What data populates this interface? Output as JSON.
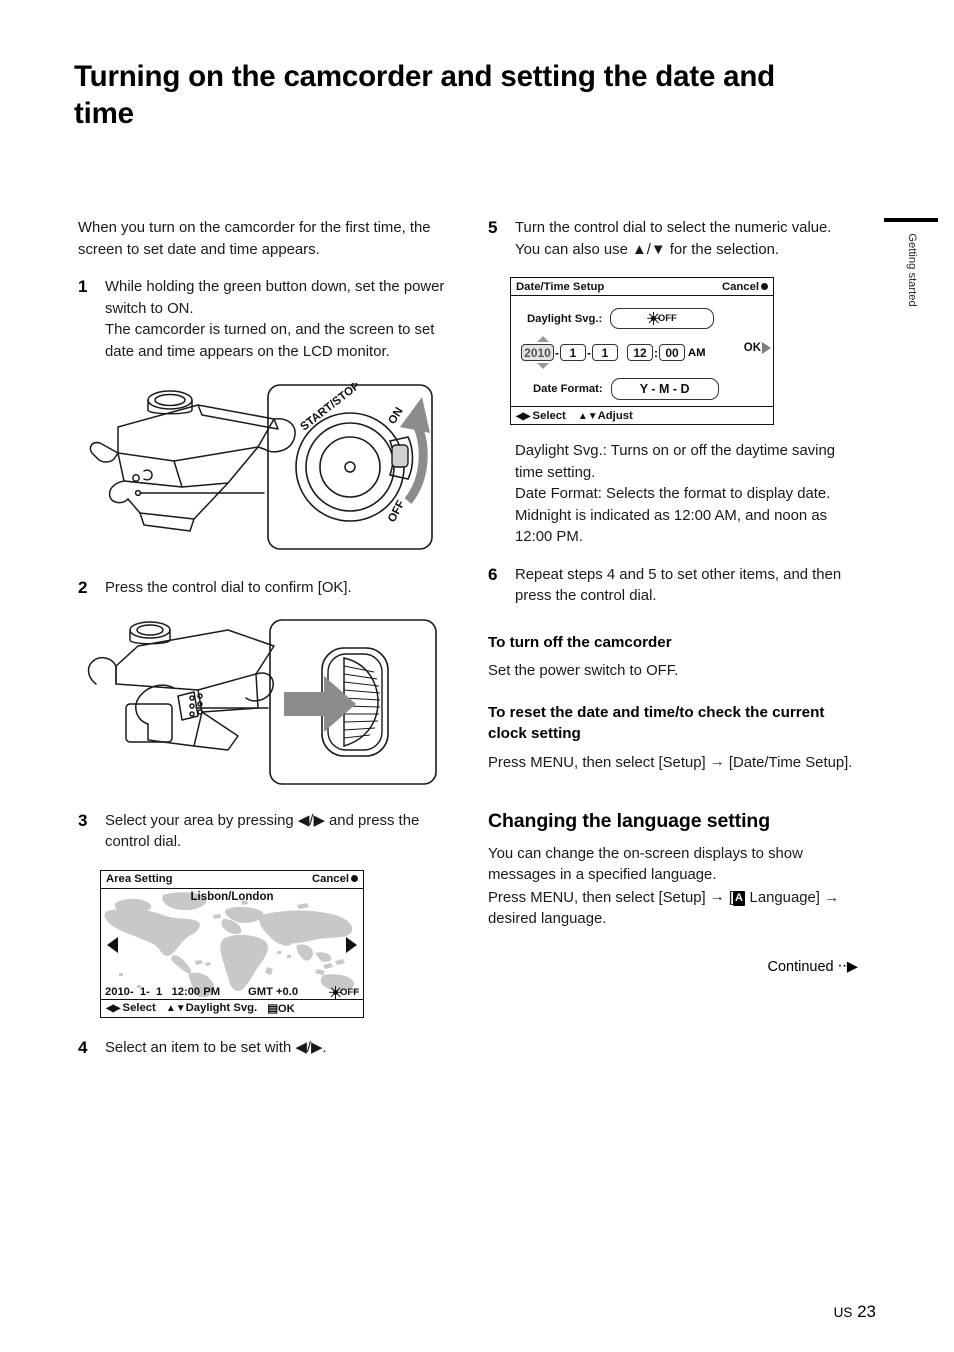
{
  "page": {
    "title": "Turning on the camcorder and setting the date and time",
    "side_tab": "Getting started",
    "page_number": "23",
    "page_prefix": "US",
    "continued": "Continued"
  },
  "left_column": {
    "intro": "When you turn on the camcorder for the first time, the screen to set date and time appears.",
    "steps": [
      {
        "num": "1",
        "text": "While holding the green button down, set the power switch to ON.",
        "text2": "The camcorder is turned on, and the screen to set date and time appears on the LCD monitor."
      },
      {
        "num": "2",
        "text": "Press the control dial to confirm [OK]."
      },
      {
        "num": "3",
        "text": "Select your area by pressing ◀/▶ and press the control dial."
      },
      {
        "num": "4",
        "text": "Select an item to be set with ◀/▶."
      }
    ],
    "illustration_1": {
      "name": "camcorder-power-switch-diagram",
      "labels": [
        "START/STOP",
        "ON",
        "OFF"
      ]
    },
    "illustration_2": {
      "name": "camcorder-control-dial-diagram",
      "labels": []
    },
    "area_screen": {
      "title": "Area Setting",
      "cancel": "Cancel",
      "city": "Lisbon/London",
      "date": "2010-  1-  1   12:00 PM",
      "gmt": "GMT +0.0",
      "dst": "OFF",
      "footer_select": "Select",
      "footer_daylight": "Daylight Svg.",
      "footer_ok": "OK"
    }
  },
  "right_column": {
    "step5": {
      "num": "5",
      "text": "Turn the control dial to select the numeric value. You can also use ▲/▼ for the selection."
    },
    "datetime_screen": {
      "title": "Date/Time Setup",
      "cancel": "Cancel",
      "daylight_label": "Daylight Svg.:",
      "daylight_value": "OFF",
      "year": "2010",
      "month": "1",
      "day": "1",
      "hour": "12",
      "minute": "00",
      "ampm": "AM",
      "date_format_label": "Date Format:",
      "date_format_value": "Y - M - D",
      "ok": "OK",
      "footer_select": "Select",
      "footer_adjust": "Adjust"
    },
    "notes": [
      "Daylight Svg.: Turns on or off the daytime saving time setting.",
      "Date Format: Selects the format to display date. Midnight is indicated as 12:00 AM, and noon as 12:00 PM."
    ],
    "step6": {
      "num": "6",
      "text": "Repeat steps 4 and 5 to set other items, and then press the control dial."
    },
    "turn_off": {
      "heading": "To turn off the camcorder",
      "body": "Set the power switch to OFF."
    },
    "reset": {
      "heading": "To reset the date and time/to check the current clock setting",
      "body_pre": "Press MENU, then select [Setup] ",
      "body_arrow": "→",
      "body_post": " [Date/Time Setup]."
    },
    "language": {
      "heading": "Changing the language setting",
      "body1": "You can change the on-screen displays to show messages in a specified language.",
      "body2_pre": "Press MENU, then select [Setup] ",
      "body2_arrow": "→",
      "body2_mid": " [",
      "body2_icon": "A",
      "body2_post": " Language] → desired language."
    }
  },
  "colors": {
    "text": "#1a1a1a",
    "heading": "#000000",
    "map_land": "#c8c8c8",
    "gray_arrow": "#7d7d7d",
    "field_gray": "#e2e2e2"
  }
}
